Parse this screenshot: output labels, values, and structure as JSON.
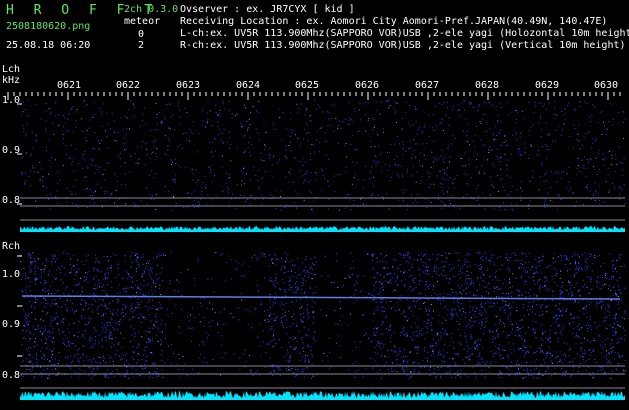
{
  "header": {
    "app_title": "H R O F F T",
    "channel_info": "2ch 0.3.0",
    "filename": "2508180620.png",
    "meteor_label": "meteor",
    "meteor_count_l": "0",
    "meteor_count_r": "2",
    "datetime": "25.08.18 06:20",
    "observer": "Ovserver              : ex. JR7CYX [ kid ]",
    "location": "Receiving Location : ex. Aomori City Aomori-Pref.JAPAN(40.49N, 140.47E)",
    "lch_info": "L-ch:ex. UV5R 113.900Mhz(SAPPORO VOR)USB ,2-ele yagi (Holozontal 10m height",
    "rch_info": "R-ch:ex. UV5R 113.900Mhz(SAPPORO VOR)USB ,2-ele yagi (Vertical 10m height)"
  },
  "lch_panel": {
    "label": "Lch",
    "unit": "kHz",
    "y_ticks": [
      "1.0",
      "0.9",
      "0.8"
    ],
    "time_ticks": [
      "0621",
      "0622",
      "0623",
      "0624",
      "0625",
      "0626",
      "0627",
      "0628",
      "0629",
      "0630"
    ]
  },
  "rch_panel": {
    "label": "Rch",
    "y_ticks": [
      "1.0",
      "0.9",
      "0.8"
    ]
  },
  "colors": {
    "background": "#000000",
    "text_green": "#5ee85e",
    "text_white": "#ffffff",
    "noise_blue": "#2a3cff",
    "signal_blue": "#6a8cff",
    "level_cyan": "#00e5ff"
  }
}
